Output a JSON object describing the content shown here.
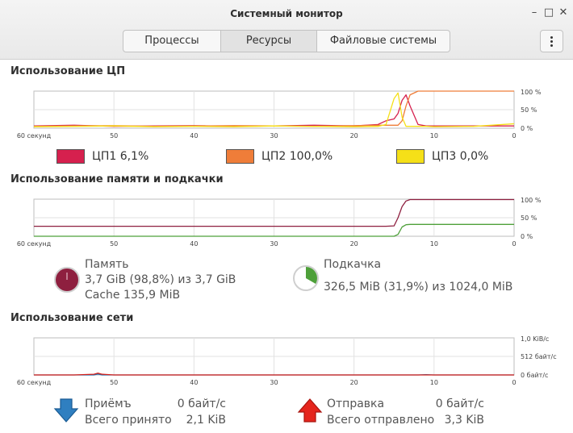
{
  "window": {
    "title": "Системный монитор"
  },
  "tabs": [
    {
      "label": "Процессы",
      "active": false
    },
    {
      "label": "Ресурсы",
      "active": true
    },
    {
      "label": "Файловые системы",
      "active": false
    }
  ],
  "sections": {
    "cpu": "Использование ЦП",
    "memory": "Использование памяти и подкачки",
    "network": "Использование сети"
  },
  "axis": {
    "x_start_label": "60 секунд",
    "x_ticks": [
      "50",
      "40",
      "30",
      "20",
      "10",
      "0"
    ],
    "pct_ticks": [
      "100 %",
      "50 %",
      "0 %"
    ],
    "net_ticks": [
      "1,0 KiB/с",
      "512 байт/с",
      "0 байт/с"
    ]
  },
  "cpu_legend": [
    {
      "label": "ЦП1",
      "value": "6,1%",
      "color": "#d6204e"
    },
    {
      "label": "ЦП2",
      "value": "100,0%",
      "color": "#ef7d39"
    },
    {
      "label": "ЦП3",
      "value": "0,0%",
      "color": "#f5e018"
    }
  ],
  "memory": {
    "ram": {
      "title": "Память",
      "usage": "3,7 GiB (98,8%) из 3,7 GiB",
      "cache": "Cache 135,9 MiB",
      "color": "#8e1f3f"
    },
    "swap": {
      "title": "Подкачка",
      "usage": "326,5 MiB (31,9%) из 1024,0 MiB",
      "color": "#4ea03a"
    }
  },
  "network": {
    "receive": {
      "label": "Приёмъ",
      "rate": "0 байт/с",
      "total_label": "Всего принято",
      "total": "2,1 KiB",
      "color": "#1f6fae"
    },
    "send": {
      "label": "Отправка",
      "rate": "0 байт/с",
      "total_label": "Всего отправлено",
      "total": "3,3 KiB",
      "color": "#d8211a"
    }
  },
  "chart_data": [
    {
      "type": "line",
      "title": "Использование ЦП",
      "x": [
        60,
        55,
        50,
        45,
        40,
        35,
        30,
        25,
        20,
        17,
        16,
        15,
        14.5,
        14,
        13.5,
        13,
        12,
        11,
        10,
        5,
        0
      ],
      "xlim": [
        60,
        0
      ],
      "ylim": [
        0,
        100
      ],
      "series": [
        {
          "name": "ЦП1",
          "color": "#d6204e",
          "values": [
            6,
            8,
            5,
            6,
            7,
            5,
            6,
            8,
            6,
            10,
            20,
            25,
            40,
            75,
            90,
            60,
            10,
            6,
            6,
            6,
            6
          ]
        },
        {
          "name": "ЦП2",
          "color": "#ef7d39",
          "values": [
            5,
            6,
            7,
            5,
            6,
            7,
            6,
            5,
            7,
            8,
            8,
            8,
            8,
            20,
            60,
            90,
            100,
            100,
            100,
            100,
            100
          ]
        },
        {
          "name": "ЦП3",
          "color": "#f5e018",
          "values": [
            4,
            5,
            6,
            4,
            5,
            4,
            6,
            5,
            4,
            5,
            10,
            80,
            95,
            30,
            5,
            5,
            5,
            5,
            4,
            5,
            12
          ]
        }
      ]
    },
    {
      "type": "line",
      "title": "Использование памяти и подкачки",
      "x": [
        60,
        50,
        40,
        30,
        20,
        16,
        15,
        14.5,
        14,
        13.5,
        13,
        12,
        10,
        5,
        0
      ],
      "xlim": [
        60,
        0
      ],
      "ylim": [
        0,
        100
      ],
      "series": [
        {
          "name": "Память",
          "color": "#8e1f3f",
          "values": [
            27,
            27,
            27,
            27,
            27,
            27,
            28,
            50,
            80,
            95,
            99,
            99,
            99,
            99,
            99
          ]
        },
        {
          "name": "Подкачка",
          "color": "#4ea03a",
          "values": [
            0,
            0,
            0,
            0,
            0,
            0,
            0,
            5,
            25,
            31,
            32,
            32,
            32,
            32,
            32
          ]
        }
      ]
    },
    {
      "type": "line",
      "title": "Использование сети",
      "x": [
        60,
        55,
        52.5,
        52,
        51.5,
        50,
        40,
        30,
        20,
        12,
        11,
        10,
        0
      ],
      "xlim": [
        60,
        0
      ],
      "ylim": [
        0,
        1024
      ],
      "series": [
        {
          "name": "Приёмъ",
          "color": "#1f6fae",
          "values": [
            0,
            0,
            0,
            25,
            0,
            0,
            0,
            0,
            0,
            0,
            8,
            0,
            0
          ]
        },
        {
          "name": "Отправка",
          "color": "#d8211a",
          "values": [
            0,
            0,
            20,
            50,
            20,
            0,
            0,
            0,
            0,
            0,
            0,
            0,
            0
          ]
        }
      ]
    }
  ]
}
